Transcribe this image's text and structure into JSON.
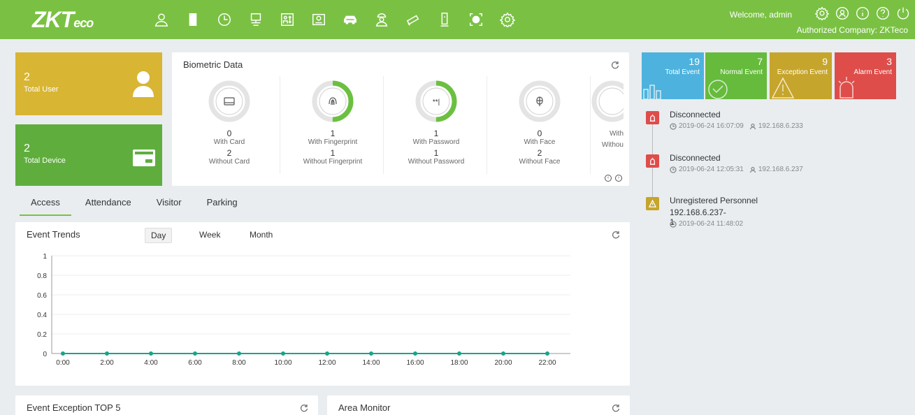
{
  "header": {
    "logo_main": "ZKT",
    "logo_tail": "eco",
    "nav_icons": [
      "personnel-icon",
      "access-door-icon",
      "attendance-clock-icon",
      "elevator-icon",
      "visitor-icon",
      "badge-icon",
      "parking-car-icon",
      "patrol-icon",
      "video-camera-icon",
      "ent-terminal-icon",
      "face-scan-icon",
      "system-gear-icon"
    ],
    "welcome": "Welcome, admin",
    "company": "Authorized Company: ZKTeco",
    "sys_icons": [
      "settings-icon",
      "user-profile-icon",
      "info-icon",
      "help-icon",
      "logout-icon"
    ]
  },
  "tiles": {
    "user": {
      "value": "2",
      "label": "Total User",
      "color": "#d8b533"
    },
    "device": {
      "value": "2",
      "label": "Total Device",
      "color": "#5fae3d"
    }
  },
  "biometric": {
    "title": "Biometric Data",
    "items": [
      {
        "icon": "card-icon",
        "with_value": "0",
        "with_label": "With Card",
        "without_value": "2",
        "without_label": "Without Card",
        "ratio": 0.0
      },
      {
        "icon": "fingerprint-icon",
        "with_value": "1",
        "with_label": "With Fingerprint",
        "without_value": "1",
        "without_label": "Without Fingerprint",
        "ratio": 0.5
      },
      {
        "icon": "password-icon",
        "with_value": "1",
        "with_label": "With Password",
        "without_value": "1",
        "without_label": "Without Password",
        "ratio": 0.5
      },
      {
        "icon": "face-icon",
        "with_value": "0",
        "with_label": "With Face",
        "without_value": "2",
        "without_label": "Without Face",
        "ratio": 0.0
      },
      {
        "icon": "palm-icon",
        "with_value": "",
        "with_label": "With",
        "without_value": "",
        "without_label": "Withou",
        "ratio": 0.0
      }
    ]
  },
  "tabs": [
    "Access",
    "Attendance",
    "Visitor",
    "Parking"
  ],
  "trends": {
    "title": "Event Trends",
    "periods": [
      "Day",
      "Week",
      "Month"
    ]
  },
  "chart_data": {
    "type": "line",
    "title": "Event Trends",
    "x": [
      "0:00",
      "2:00",
      "4:00",
      "6:00",
      "8:00",
      "10:00",
      "12:00",
      "14:00",
      "16:00",
      "18:00",
      "20:00",
      "22:00"
    ],
    "series": [
      {
        "values": [
          0,
          0,
          0,
          0,
          0,
          0,
          0,
          0,
          0,
          0,
          0,
          0
        ]
      }
    ],
    "ylim": [
      0,
      1
    ],
    "yticks": [
      "0",
      "0.2",
      "0.4",
      "0.6",
      "0.8",
      "1"
    ],
    "grid": true,
    "series_color": "#1aa38a"
  },
  "panels": {
    "exception": "Event Exception TOP 5",
    "area": "Area Monitor"
  },
  "events": {
    "total": {
      "value": "19",
      "label": "Total Event",
      "color": "#4db3de",
      "icon": "bar-chart-icon"
    },
    "normal": {
      "value": "7",
      "label": "Normal Event",
      "color": "#66bb3d",
      "icon": "check-circle-icon"
    },
    "exception": {
      "value": "9",
      "label": "Exception Event",
      "color": "#c6a52c",
      "icon": "warning-icon"
    },
    "alarm": {
      "value": "3",
      "label": "Alarm Event",
      "color": "#de4d4a",
      "icon": "alarm-light-icon"
    }
  },
  "timeline": [
    {
      "title": "Disconnected",
      "time": "2019-06-24 16:07:09",
      "ip": "192.168.6.233",
      "type": "alarm",
      "color": "#de4d4a"
    },
    {
      "title": "Disconnected",
      "time": "2019-06-24 12:05:31",
      "ip": "192.168.6.237",
      "type": "alarm",
      "color": "#de4d4a"
    },
    {
      "title": "Unregistered Personnel",
      "sub": "192.168.6.237-1",
      "time": "2019-06-24 11:48:02",
      "type": "exception",
      "color": "#c6a52c"
    }
  ]
}
